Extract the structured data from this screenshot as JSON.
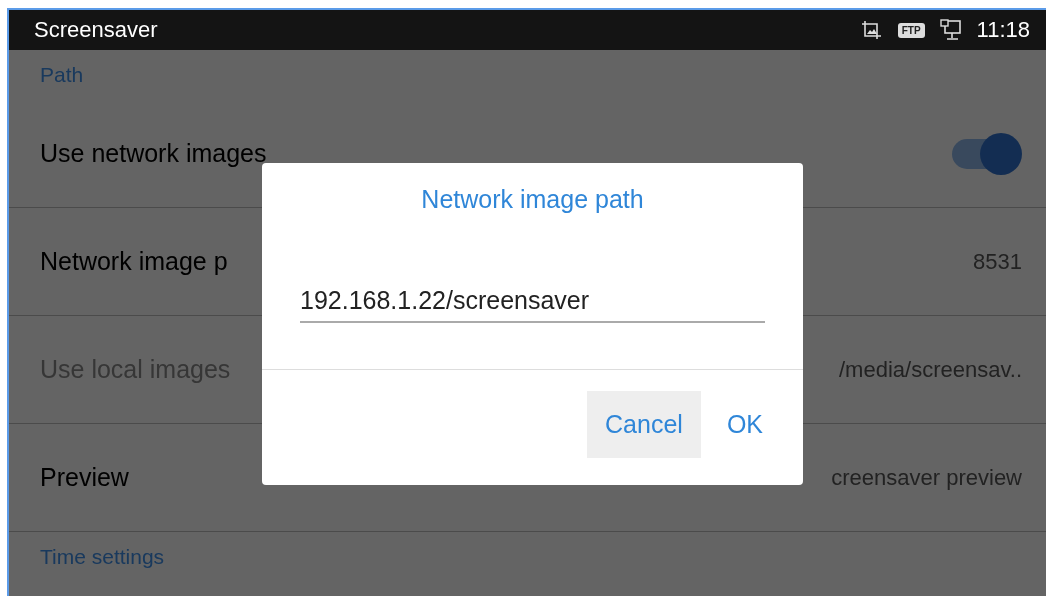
{
  "status_bar": {
    "title": "Screensaver",
    "badge": "FTP",
    "time": "11:18"
  },
  "settings": [
    {
      "kind": "header",
      "label": "Path"
    },
    {
      "kind": "toggle",
      "label": "Use network images",
      "on": true,
      "disabled": false
    },
    {
      "kind": "value",
      "label": "Network image p",
      "value": "8531",
      "disabled": false
    },
    {
      "kind": "value",
      "label": "Use local images",
      "value": "/media/screensav..",
      "disabled": true
    },
    {
      "kind": "value",
      "label": "Preview",
      "value": "creensaver preview",
      "disabled": false
    },
    {
      "kind": "header",
      "label": "Time settings"
    }
  ],
  "dialog": {
    "title": "Network image path",
    "value": "192.168.1.22/screensaver",
    "buttons": [
      {
        "label": "Cancel",
        "selected": true
      },
      {
        "label": "OK",
        "selected": false
      }
    ]
  }
}
